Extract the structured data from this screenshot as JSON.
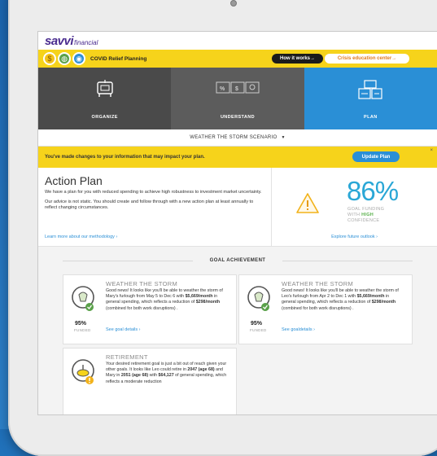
{
  "brand": {
    "main": "savvi",
    "sub": "financial"
  },
  "covid_bar": {
    "title": "COVID Relief Planning",
    "how_it_works": "How it works→",
    "crisis_center": "Crisis education center→"
  },
  "tabs": [
    {
      "label": "ORGANIZE"
    },
    {
      "label": "UNDERSTAND"
    },
    {
      "label": "PLAN"
    }
  ],
  "scenario": {
    "label": "WEATHER THE STORM SCENARIO"
  },
  "notice": {
    "text": "You've made changes to your information that may impact your plan.",
    "update_label": "Update Plan",
    "close": "×"
  },
  "action_plan": {
    "title": "Action Plan",
    "para1": "We have a plan for you with reduced spending to achieve high robustness to investment market uncertainty.",
    "para2": "Our advice is not static. You should create and follow through with a new action plan at least annually to reflect changing circumstances.",
    "methodology_link": "Learn more about our methodology ›",
    "percent": "86%",
    "confidence_line1": "GOAL FUNDING",
    "confidence_with": "WITH",
    "confidence_level": "HIGH",
    "confidence_line3": "CONFIDENCE",
    "explore_link": "Explore future outlook ›"
  },
  "goals": {
    "heading": "GOAL ACHIEVEMENT",
    "cards": [
      {
        "title": "WEATHER THE STORM",
        "body_html": "Good news! It looks like you'll be able to weather the storm of Mary's furlough from May 5 to Dec 6 with <b>$5,669/month</b> in general spending, which reflects a reduction of <b>$298/month</b> (combined for both work disruptions) .",
        "percent": "95%",
        "funded": "FUNDED",
        "link": "See goal details ›"
      },
      {
        "title": "WEATHER THE STORM",
        "body_html": "Good news! It looks like you'll be able to weather the storm of Leo's furlough from Apr 2 to Dec 1 with <b>$5,669/month</b> in general spending, which reflects a reduction of <b>$298/month</b> (combined for both work disruptions) .",
        "percent": "95%",
        "funded": "FUNDED",
        "link": "See goaldetails ›"
      },
      {
        "title": "RETIREMENT",
        "body_html": "Your desired retirement goal is just a bit out of reach given your other goals. It looks like Leo could retire in <b>2047 (age 68)</b> and Mary in <b>2051 (age 68)</b> with <b>$64,127</b> of general spending, which reflects a moderate reduction"
      }
    ]
  },
  "colors": {
    "brand_purple": "#4a2c8f",
    "yellow": "#f6d31b",
    "plan_blue": "#2a8fd6",
    "dark_tab": "#4a4a4a",
    "confidence_green": "#58b04a"
  }
}
